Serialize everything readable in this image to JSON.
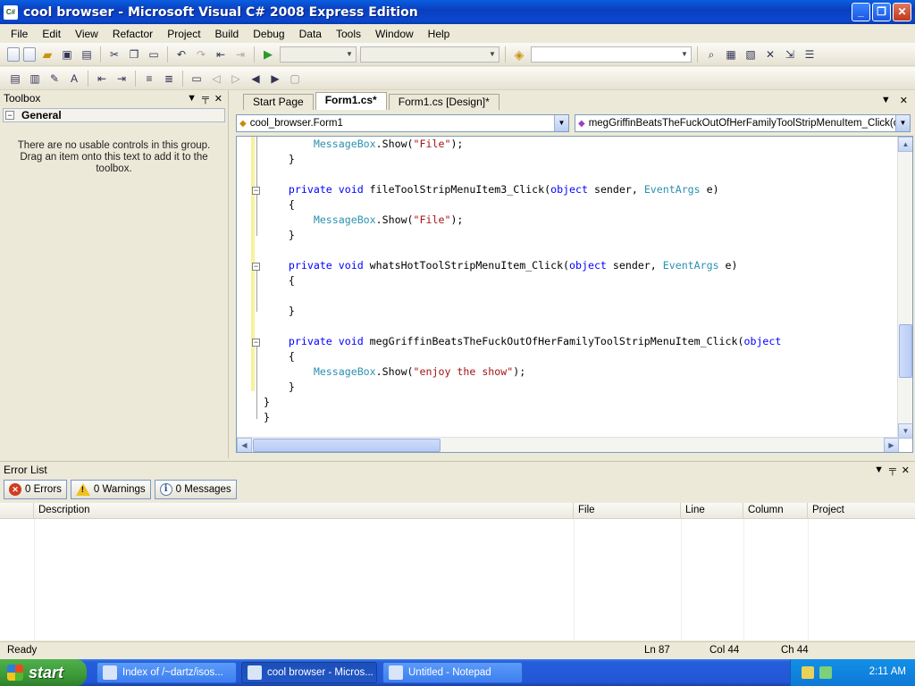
{
  "window": {
    "title": "cool browser - Microsoft Visual C# 2008 Express Edition",
    "app_icon": "C#",
    "controls": {
      "minimize": "_",
      "maximize": "❐",
      "close": "✕"
    }
  },
  "menu": [
    "File",
    "Edit",
    "View",
    "Refactor",
    "Project",
    "Build",
    "Debug",
    "Data",
    "Tools",
    "Window",
    "Help"
  ],
  "toolbox": {
    "title": "Toolbox",
    "group": "General",
    "hint": "There are no usable controls in this group. Drag an item onto this text to add it to the toolbox."
  },
  "editor": {
    "tabs": [
      "Start Page",
      "Form1.cs*",
      "Form1.cs [Design]*"
    ],
    "active_tab": "Form1.cs*",
    "type_combo": "cool_browser.Form1",
    "member_combo": "megGriffinBeatsTheFuckOutOfHerFamilyToolStripMenuItem_Click(obje",
    "code_lines": [
      [
        {
          "t": "        "
        },
        {
          "t": "MessageBox",
          "c": "ty"
        },
        {
          "t": ".Show("
        },
        {
          "t": "\"File\"",
          "c": "st"
        },
        {
          "t": ");"
        }
      ],
      [
        {
          "t": "    }"
        }
      ],
      [
        {
          "t": ""
        }
      ],
      [
        {
          "t": "    "
        },
        {
          "t": "private void",
          "c": "kw"
        },
        {
          "t": " fileToolStripMenuItem3_Click("
        },
        {
          "t": "object",
          "c": "kw"
        },
        {
          "t": " sender, "
        },
        {
          "t": "EventArgs",
          "c": "ty"
        },
        {
          "t": " e)"
        }
      ],
      [
        {
          "t": "    {"
        }
      ],
      [
        {
          "t": "        "
        },
        {
          "t": "MessageBox",
          "c": "ty"
        },
        {
          "t": ".Show("
        },
        {
          "t": "\"File\"",
          "c": "st"
        },
        {
          "t": ");"
        }
      ],
      [
        {
          "t": "    }"
        }
      ],
      [
        {
          "t": ""
        }
      ],
      [
        {
          "t": "    "
        },
        {
          "t": "private void",
          "c": "kw"
        },
        {
          "t": " whatsHotToolStripMenuItem_Click("
        },
        {
          "t": "object",
          "c": "kw"
        },
        {
          "t": " sender, "
        },
        {
          "t": "EventArgs",
          "c": "ty"
        },
        {
          "t": " e)"
        }
      ],
      [
        {
          "t": "    {"
        }
      ],
      [
        {
          "t": ""
        }
      ],
      [
        {
          "t": "    }"
        }
      ],
      [
        {
          "t": ""
        }
      ],
      [
        {
          "t": "    "
        },
        {
          "t": "private void",
          "c": "kw"
        },
        {
          "t": " megGriffinBeatsTheFuckOutOfHerFamilyToolStripMenuItem_Click("
        },
        {
          "t": "object",
          "c": "kw"
        }
      ],
      [
        {
          "t": "    {"
        }
      ],
      [
        {
          "t": "        "
        },
        {
          "t": "MessageBox",
          "c": "ty"
        },
        {
          "t": ".Show("
        },
        {
          "t": "\"enjoy the show\"",
          "c": "st"
        },
        {
          "t": ");"
        }
      ],
      [
        {
          "t": "    }"
        }
      ],
      [
        {
          "t": "}"
        }
      ],
      [
        {
          "t": "}"
        }
      ]
    ]
  },
  "error_list": {
    "title": "Error List",
    "errors": "0 Errors",
    "warnings": "0 Warnings",
    "messages": "0 Messages",
    "columns": [
      "",
      "Description",
      "File",
      "Line",
      "Column",
      "Project"
    ]
  },
  "status": {
    "text": "Ready",
    "ln": "Ln 87",
    "col": "Col 44",
    "ch": "Ch 44"
  },
  "taskbar": {
    "start": "start",
    "items": [
      "Index of /~dartz/isos...",
      "cool browser - Micros...",
      "Untitled - Notepad"
    ],
    "active_index": 1,
    "clock": "2:11 AM"
  },
  "colors": {
    "keyword": "#0000ff",
    "type": "#2b91af",
    "string": "#a31515",
    "titlebar": "#0a47d0"
  }
}
